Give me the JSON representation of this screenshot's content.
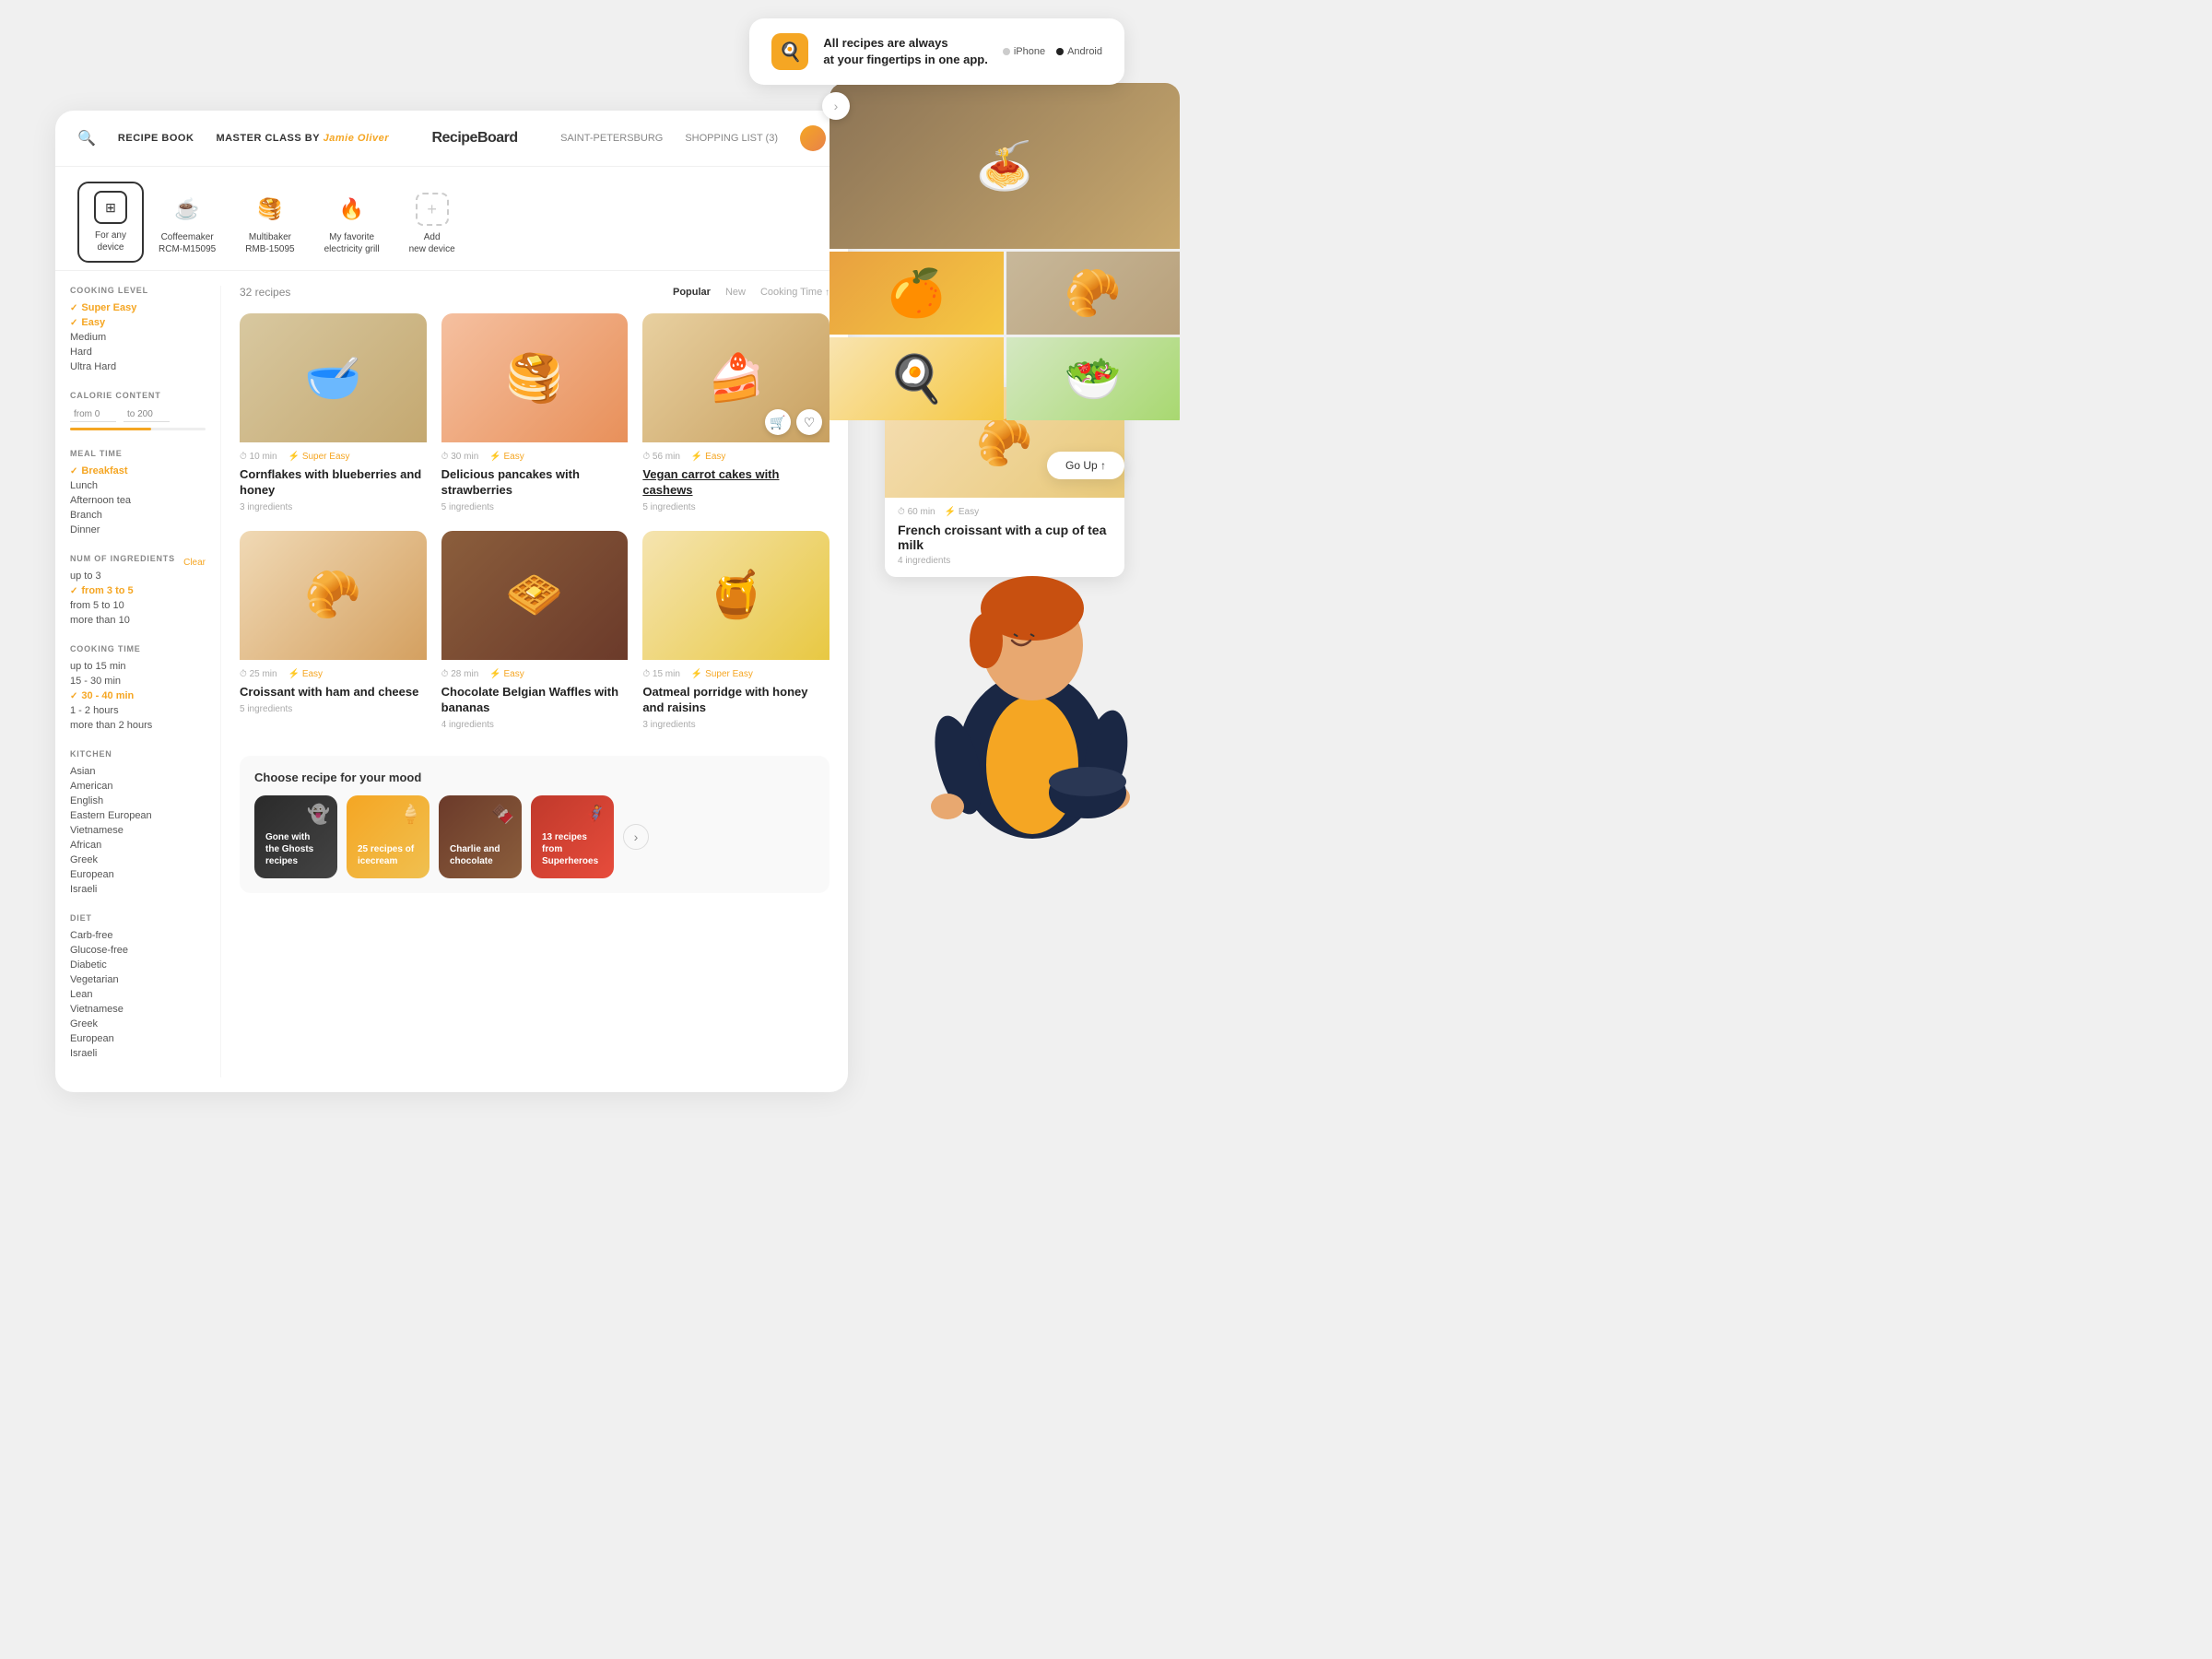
{
  "app": {
    "title": "RecipeBoard"
  },
  "promo": {
    "icon": "🍳",
    "line1": "All recipes are always",
    "line2": "at your fingertips in one app.",
    "badge_ios": "iPhone",
    "badge_android": "Android"
  },
  "nav": {
    "search_placeholder": "Search",
    "recipe_book": "RECIPE BOOK",
    "masterclass_prefix": "MASTER CLASS BY",
    "masterclass_name": "Jamie Oliver",
    "logo": "RecipeBoard",
    "location": "SAINT-PETERSBURG",
    "shopping_list": "SHOPPING LIST (3)"
  },
  "devices": [
    {
      "id": "for-any",
      "label": "For any\ndevice",
      "icon": "⊞",
      "active": true
    },
    {
      "id": "coffeemaker",
      "label": "Coffeemaker\nRCM-M15095",
      "icon": "☕"
    },
    {
      "id": "multibaker",
      "label": "Multibaker\nRMB-15095",
      "icon": "🥞"
    },
    {
      "id": "grill",
      "label": "My favorite\nelectricity grill",
      "icon": "🔥"
    },
    {
      "id": "add",
      "label": "Add\nnew device",
      "icon": "+"
    }
  ],
  "filters": {
    "cooking_level": {
      "title": "COOKING LEVEL",
      "items": [
        {
          "label": "Super Easy",
          "active": true
        },
        {
          "label": "Easy",
          "active": true
        },
        {
          "label": "Medium",
          "active": false
        },
        {
          "label": "Hard",
          "active": false
        },
        {
          "label": "Ultra Hard",
          "active": false
        }
      ]
    },
    "calorie_content": {
      "title": "CALORIE CONTENT",
      "from_label": "from 0",
      "to_label": "to 200"
    },
    "meal_time": {
      "title": "MEAL TIME",
      "items": [
        {
          "label": "Breakfast",
          "active": true
        },
        {
          "label": "Lunch",
          "active": false
        },
        {
          "label": "Afternoon tea",
          "active": false
        },
        {
          "label": "Branch",
          "active": false
        },
        {
          "label": "Dinner",
          "active": false
        }
      ]
    },
    "num_ingredients": {
      "title": "NUM OF INGREDIENTS",
      "clear_label": "Clear",
      "items": [
        {
          "label": "up to 3",
          "active": false
        },
        {
          "label": "from 3 to 5",
          "active": true
        },
        {
          "label": "from 5 to 10",
          "active": false
        },
        {
          "label": "more than 10",
          "active": false
        }
      ]
    },
    "cooking_time": {
      "title": "COOKING TIME",
      "items": [
        {
          "label": "up to 15 min",
          "active": false
        },
        {
          "label": "15 - 30 min",
          "active": false
        },
        {
          "label": "30 - 40 min",
          "active": true
        },
        {
          "label": "1 - 2 hours",
          "active": false
        },
        {
          "label": "more than 2 hours",
          "active": false
        }
      ]
    },
    "kitchen": {
      "title": "KITCHEN",
      "items": [
        {
          "label": "Asian"
        },
        {
          "label": "American"
        },
        {
          "label": "English"
        },
        {
          "label": "Eastern European"
        },
        {
          "label": "Vietnamese"
        },
        {
          "label": "African"
        },
        {
          "label": "Greek"
        },
        {
          "label": "European"
        },
        {
          "label": "Israeli"
        }
      ]
    },
    "diet": {
      "title": "DIET",
      "items": [
        {
          "label": "Carb-free"
        },
        {
          "label": "Glucose-free"
        },
        {
          "label": "Diabetic"
        },
        {
          "label": "Vegetarian"
        },
        {
          "label": "Lean"
        },
        {
          "label": "Vietnamese"
        },
        {
          "label": "Greek"
        },
        {
          "label": "European"
        },
        {
          "label": "Israeli"
        }
      ]
    }
  },
  "recipes": {
    "count": "32 recipes",
    "sort_tabs": [
      {
        "label": "Popular",
        "active": true
      },
      {
        "label": "New",
        "active": false
      },
      {
        "label": "Cooking Time",
        "active": false,
        "has_arrow": true
      }
    ],
    "items": [
      {
        "id": 1,
        "time": "10 min",
        "difficulty": "Super Easy",
        "name": "Cornflakes with blueberries and honey",
        "ingredients_count": "3 ingredients",
        "bg_color": "#e8d5b0",
        "emoji": "🥣"
      },
      {
        "id": 2,
        "time": "30 min",
        "difficulty": "Easy",
        "name": "Delicious pancakes with strawberries",
        "ingredients_count": "5 ingredients",
        "bg_color": "#f5d4c0",
        "emoji": "🥞"
      },
      {
        "id": 3,
        "time": "56 min",
        "difficulty": "Easy",
        "name": "Vegan carrot cakes with cashews",
        "ingredients_count": "5 ingredients",
        "bg_color": "#e8d8c0",
        "emoji": "🍰",
        "has_link": true
      },
      {
        "id": 4,
        "time": "25 min",
        "difficulty": "Easy",
        "name": "Croissant with ham and cheese",
        "ingredients_count": "5 ingredients",
        "bg_color": "#f0d9b5",
        "emoji": "🥐"
      },
      {
        "id": 5,
        "time": "28 min",
        "difficulty": "Easy",
        "name": "Chocolate Belgian Waffles with bananas",
        "ingredients_count": "4 ingredients",
        "bg_color": "#c8a07a",
        "emoji": "🧇"
      },
      {
        "id": 6,
        "time": "15 min",
        "difficulty": "Super Easy",
        "name": "Oatmeal porridge with honey and raisins",
        "ingredients_count": "3 ingredients",
        "bg_color": "#f5e4b0",
        "emoji": "🍯"
      }
    ]
  },
  "mood": {
    "title": "Choose recipe for your mood",
    "cards": [
      {
        "id": "ghost",
        "label": "Gone with the Ghosts recipes",
        "class": "mood-ghost",
        "icon": "👻"
      },
      {
        "id": "icecream",
        "label": "25 recipes of icecream",
        "class": "mood-icecream",
        "icon": "🍦"
      },
      {
        "id": "chocolate",
        "label": "Charlie and chocolate",
        "class": "mood-chocolate",
        "icon": "🍫"
      },
      {
        "id": "superheroes",
        "label": "13 recipes from Superheroes",
        "class": "mood-superheroes",
        "icon": "🦸"
      }
    ],
    "arrow_label": "›"
  },
  "side_recipe": {
    "time": "60 min",
    "difficulty": "Easy",
    "name": "French croissant with a cup of tea milk",
    "ingredients_count": "4 ingredients",
    "emoji": "🥐"
  },
  "go_up": "Go Up ↑"
}
